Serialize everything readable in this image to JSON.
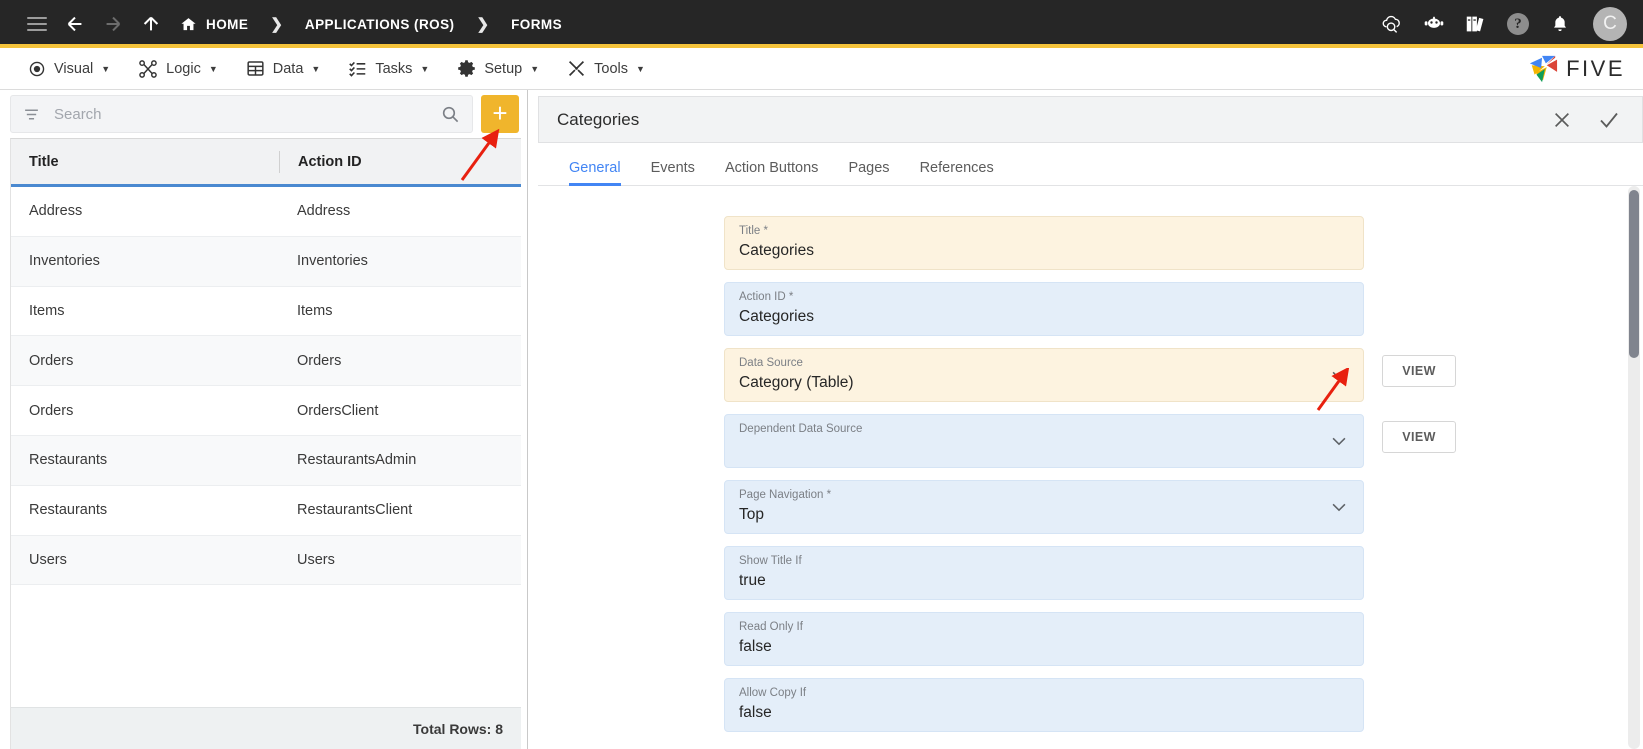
{
  "topbar": {
    "icons": {
      "menu": "hamburger-icon",
      "back": "arrow-left-icon",
      "forward": "arrow-right-icon",
      "up": "arrow-up-icon",
      "home": "home-icon",
      "cloud_search": "cloud-search-icon",
      "assistant": "robot-icon",
      "library": "books-icon",
      "help": "?",
      "notifications": "bell-icon"
    },
    "breadcrumbs": [
      {
        "label": "HOME",
        "icon": "home-icon"
      },
      {
        "label": "APPLICATIONS (ROS)"
      },
      {
        "label": "FORMS"
      }
    ],
    "separator": "❯",
    "avatar_initial": "C",
    "accent_color": "#F5C33B",
    "background_color": "#262626"
  },
  "menubar": {
    "items": [
      {
        "label": "Visual",
        "icon": "eye-icon"
      },
      {
        "label": "Logic",
        "icon": "logic-nodes-icon"
      },
      {
        "label": "Data",
        "icon": "table-grid-icon"
      },
      {
        "label": "Tasks",
        "icon": "task-list-icon"
      },
      {
        "label": "Setup",
        "icon": "gear-icon"
      },
      {
        "label": "Tools",
        "icon": "tools-icon"
      }
    ],
    "caret": "▼",
    "logo_text": "FIVE"
  },
  "left_panel": {
    "search": {
      "placeholder": "Search",
      "value": "",
      "filter_icon": "filter-icon",
      "search_icon": "search-icon"
    },
    "add_button": {
      "label": "+",
      "color": "#F0B52C"
    },
    "table": {
      "columns": [
        "Title",
        "Action ID"
      ],
      "header_underline_color": "#4a89d0",
      "rows": [
        {
          "title": "Address",
          "action_id": "Address"
        },
        {
          "title": "Inventories",
          "action_id": "Inventories"
        },
        {
          "title": "Items",
          "action_id": "Items"
        },
        {
          "title": "Orders",
          "action_id": "Orders"
        },
        {
          "title": "Orders",
          "action_id": "OrdersClient"
        },
        {
          "title": "Restaurants",
          "action_id": "RestaurantsAdmin"
        },
        {
          "title": "Restaurants",
          "action_id": "RestaurantsClient"
        },
        {
          "title": "Users",
          "action_id": "Users"
        }
      ],
      "footer": "Total Rows: 8"
    }
  },
  "right_panel": {
    "title": "Categories",
    "actions": {
      "close": "close-icon",
      "save": "check-icon"
    },
    "tabs": [
      {
        "label": "General",
        "active": true
      },
      {
        "label": "Events",
        "active": false
      },
      {
        "label": "Action Buttons",
        "active": false
      },
      {
        "label": "Pages",
        "active": false
      },
      {
        "label": "References",
        "active": false
      }
    ],
    "active_tab_color": "#4285F4",
    "fields": [
      {
        "label": "Title *",
        "value": "Categories",
        "style": "cream",
        "dropdown": false,
        "view_button": null
      },
      {
        "label": "Action ID *",
        "value": "Categories",
        "style": "blue",
        "dropdown": false,
        "view_button": null
      },
      {
        "label": "Data Source",
        "value": "Category (Table)",
        "style": "cream",
        "dropdown": true,
        "view_button": "VIEW"
      },
      {
        "label": "Dependent Data Source",
        "value": "",
        "style": "blue",
        "dropdown": true,
        "view_button": "VIEW"
      },
      {
        "label": "Page Navigation *",
        "value": "Top",
        "style": "blue",
        "dropdown": true,
        "view_button": null
      },
      {
        "label": "Show Title If",
        "value": "true",
        "style": "blue",
        "dropdown": false,
        "view_button": null
      },
      {
        "label": "Read Only If",
        "value": "false",
        "style": "blue",
        "dropdown": false,
        "view_button": null
      },
      {
        "label": "Allow Copy If",
        "value": "false",
        "style": "blue",
        "dropdown": false,
        "view_button": null
      }
    ]
  },
  "annotations": {
    "color": "#E8200F",
    "arrows": [
      {
        "name": "arrow-to-add-button",
        "target": "add-record-button"
      },
      {
        "name": "arrow-to-data-source-dropdown",
        "target": "data-source-dropdown-chevron"
      }
    ]
  }
}
